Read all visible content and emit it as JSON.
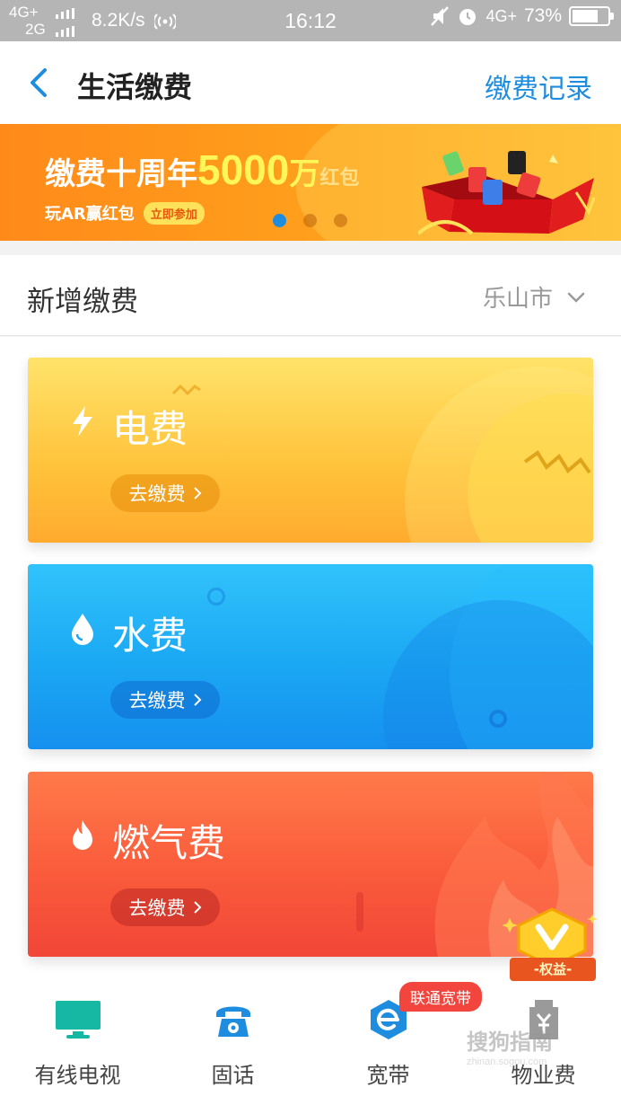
{
  "status_bar": {
    "net_top": "4G+",
    "net_bottom": "2G",
    "speed": "8.2K/s",
    "time": "16:12",
    "net_right": "4G+",
    "battery": "73%",
    "battery_level": 0.73
  },
  "header": {
    "title": "生活缴费",
    "records": "缴费记录",
    "accent": "#1e8ddf"
  },
  "banner": {
    "part1": "缴费十周年",
    "amount": "5000",
    "part2": "万",
    "part3": "红包",
    "sub": "玩AR赢红包",
    "cta": "立即参加",
    "dots": 3,
    "active_dot": 0
  },
  "section": {
    "title": "新增缴费",
    "city": "乐山市"
  },
  "cards": {
    "electricity": {
      "title": "电费",
      "button": "去缴费",
      "icon": "lightning-icon"
    },
    "water": {
      "title": "水费",
      "button": "去缴费",
      "icon": "water-drop-icon"
    },
    "gas": {
      "title": "燃气费",
      "button": "去缴费",
      "icon": "flame-icon"
    }
  },
  "bottom_nav": {
    "items": [
      {
        "label": "有线电视",
        "icon": "tv-icon",
        "color": "#16b8a4"
      },
      {
        "label": "固话",
        "icon": "telephone-icon",
        "color": "#1e8ddf"
      },
      {
        "label": "宽带",
        "icon": "broadband-icon",
        "color": "#1e8ddf"
      },
      {
        "label": "物业费",
        "icon": "property-fee-icon",
        "color": "#9a9a9a"
      }
    ],
    "badge": "联通宽带"
  },
  "rights_badge": {
    "label": "-权益-"
  },
  "watermark": {
    "text": "搜狗指南",
    "sub": "zhinan.sogou.com"
  }
}
